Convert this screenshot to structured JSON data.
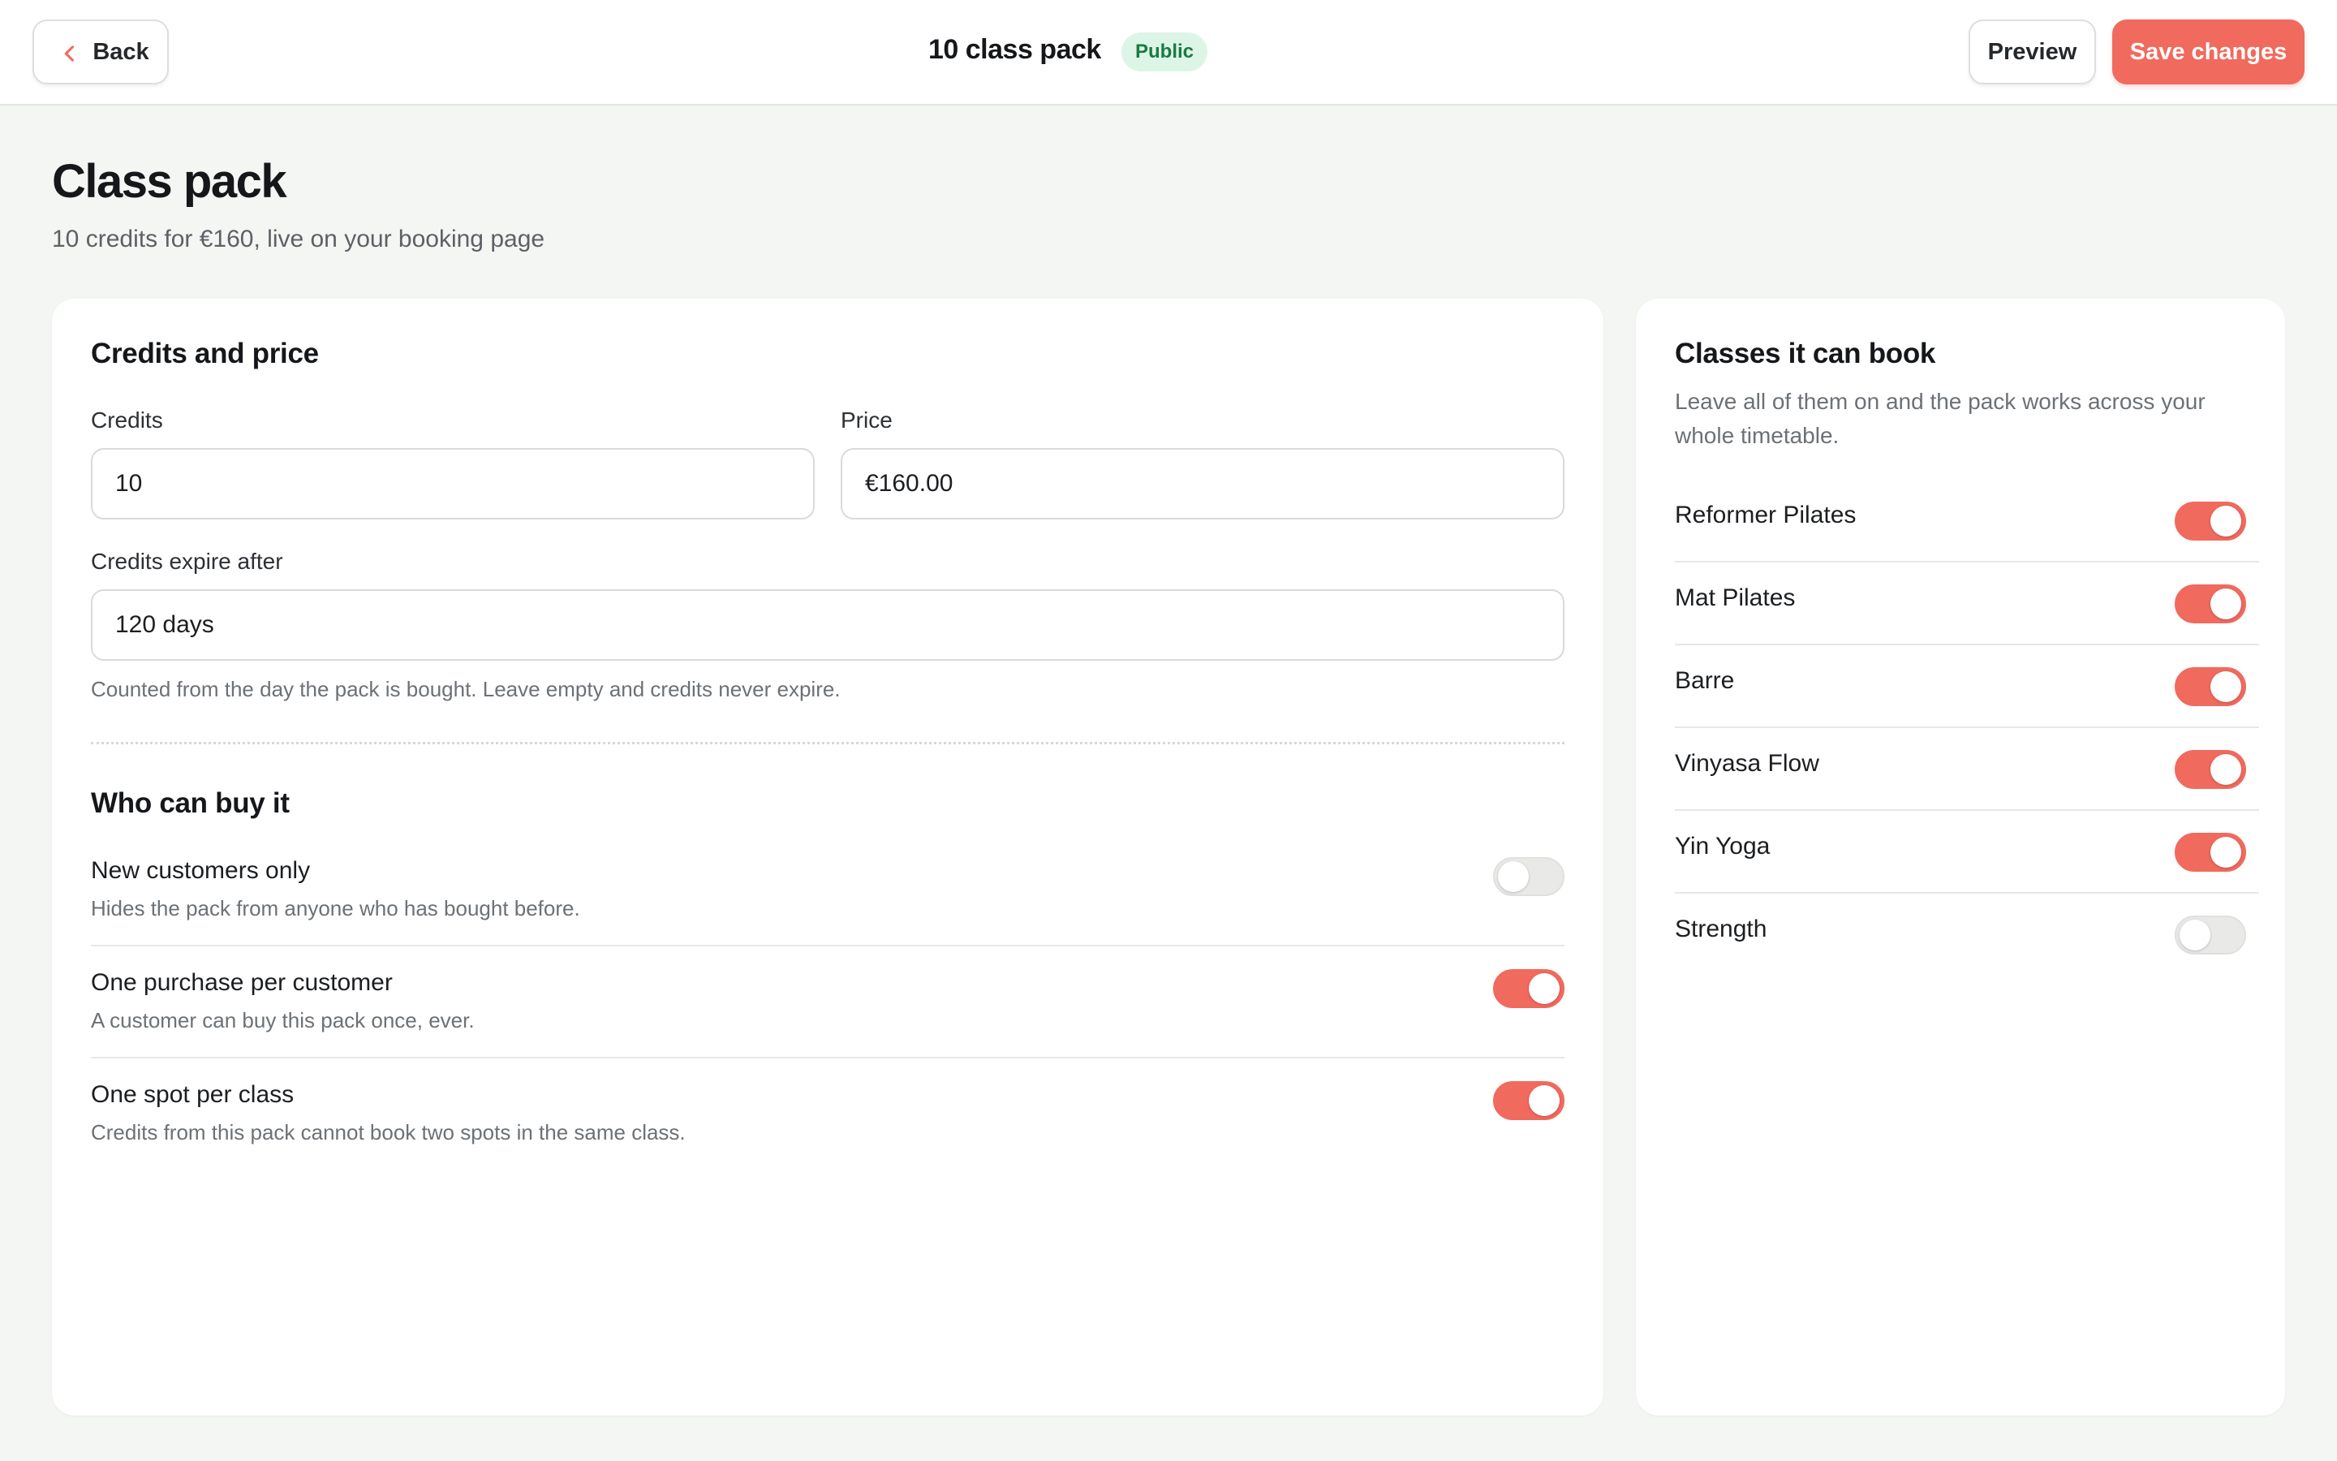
{
  "header": {
    "back_label": "Back",
    "title": "10 class pack",
    "badge": "Public",
    "preview_label": "Preview",
    "save_label": "Save changes"
  },
  "page": {
    "title": "Class pack",
    "subtitle": "10 credits for €160, live on your booking page"
  },
  "credits_price": {
    "heading": "Credits and price",
    "credits_label": "Credits",
    "credits_value": "10",
    "price_label": "Price",
    "price_value": "€160.00",
    "expire_label": "Credits expire after",
    "expire_value": "120 days",
    "expire_hint": "Counted from the day the pack is bought. Leave empty and credits never expire."
  },
  "who_can_buy": {
    "heading": "Who can buy it",
    "rules": [
      {
        "title": "New customers only",
        "desc": "Hides the pack from anyone who has bought before.",
        "enabled": false
      },
      {
        "title": "One purchase per customer",
        "desc": "A customer can buy this pack once, ever.",
        "enabled": true
      },
      {
        "title": "One spot per class",
        "desc": "Credits from this pack cannot book two spots in the same class.",
        "enabled": true
      }
    ]
  },
  "classes": {
    "heading": "Classes it can book",
    "desc": "Leave all of them on and the pack works across your whole timetable.",
    "items": [
      {
        "name": "Reformer Pilates",
        "enabled": true
      },
      {
        "name": "Mat Pilates",
        "enabled": true
      },
      {
        "name": "Barre",
        "enabled": true
      },
      {
        "name": "Vinyasa Flow",
        "enabled": true
      },
      {
        "name": "Yin Yoga",
        "enabled": true
      },
      {
        "name": "Strength",
        "enabled": false
      }
    ]
  },
  "colors": {
    "accent": "#f06a5e",
    "badge_bg": "#ddf5e6",
    "badge_text": "#1a7a44",
    "page_bg": "#f4f6f3"
  }
}
